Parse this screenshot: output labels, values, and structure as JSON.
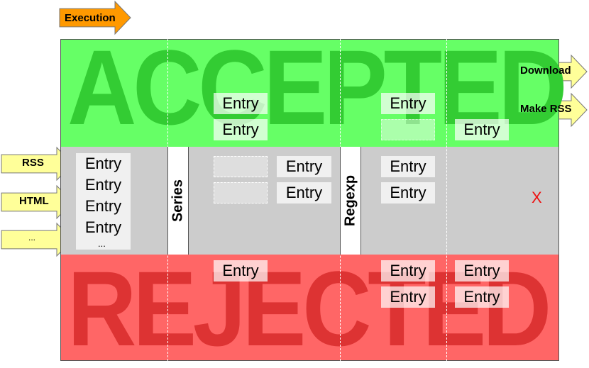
{
  "stage": {
    "execution_label": "Execution"
  },
  "bands": {
    "accepted": "ACCEPTED",
    "rejected": "REJECTED"
  },
  "inputs": [
    {
      "label": "RSS"
    },
    {
      "label": "HTML"
    },
    {
      "label": "..."
    }
  ],
  "outputs": [
    {
      "label": "Download"
    },
    {
      "label": "Make RSS"
    }
  ],
  "filters": [
    {
      "label": "Series"
    },
    {
      "label": "Regexp"
    }
  ],
  "entry_label": "Entry",
  "source_ellipsis": "...",
  "blocked_mark": "X",
  "colors": {
    "accepted_bg": "#66ff66",
    "accepted_text": "#33cc33",
    "middle_bg": "#cccccc",
    "rejected_bg": "#ff6666",
    "rejected_text": "#dd3333",
    "input_arrow": "#ffff99",
    "execution_arrow": "#ff9900",
    "output_arrow": "#ffff99"
  }
}
